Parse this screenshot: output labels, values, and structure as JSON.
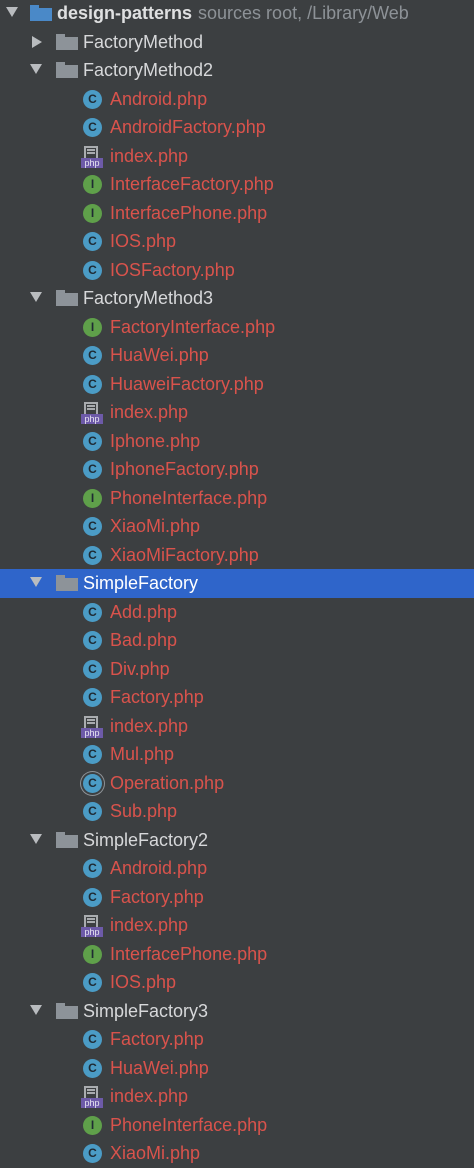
{
  "project_tree": {
    "root": {
      "name": "design-patterns",
      "suffix": "sources root,  /Library/Web",
      "icon": "folder-icon",
      "expanded": true
    },
    "rows": [
      {
        "kind": "dir",
        "label": "FactoryMethod",
        "expanded": false
      },
      {
        "kind": "dir",
        "label": "FactoryMethod2",
        "expanded": true
      },
      {
        "kind": "file",
        "icon": "class-icon",
        "label": "Android.php"
      },
      {
        "kind": "file",
        "icon": "class-icon",
        "label": "AndroidFactory.php"
      },
      {
        "kind": "file",
        "icon": "php-file-icon",
        "label": "index.php"
      },
      {
        "kind": "file",
        "icon": "interface-icon",
        "label": "InterfaceFactory.php"
      },
      {
        "kind": "file",
        "icon": "interface-icon",
        "label": "InterfacePhone.php"
      },
      {
        "kind": "file",
        "icon": "class-icon",
        "label": "IOS.php"
      },
      {
        "kind": "file",
        "icon": "class-icon",
        "label": "IOSFactory.php"
      },
      {
        "kind": "dir",
        "label": "FactoryMethod3",
        "expanded": true
      },
      {
        "kind": "file",
        "icon": "interface-icon",
        "label": "FactoryInterface.php"
      },
      {
        "kind": "file",
        "icon": "class-icon",
        "label": "HuaWei.php"
      },
      {
        "kind": "file",
        "icon": "class-icon",
        "label": "HuaweiFactory.php"
      },
      {
        "kind": "file",
        "icon": "php-file-icon",
        "label": "index.php"
      },
      {
        "kind": "file",
        "icon": "class-icon",
        "label": "Iphone.php"
      },
      {
        "kind": "file",
        "icon": "class-icon",
        "label": "IphoneFactory.php"
      },
      {
        "kind": "file",
        "icon": "interface-icon",
        "label": "PhoneInterface.php"
      },
      {
        "kind": "file",
        "icon": "class-icon",
        "label": "XiaoMi.php"
      },
      {
        "kind": "file",
        "icon": "class-icon",
        "label": "XiaoMiFactory.php"
      },
      {
        "kind": "dir",
        "label": "SimpleFactory",
        "expanded": true,
        "selected": true
      },
      {
        "kind": "file",
        "icon": "class-icon",
        "label": "Add.php"
      },
      {
        "kind": "file",
        "icon": "class-icon",
        "label": "Bad.php"
      },
      {
        "kind": "file",
        "icon": "class-icon",
        "label": "Div.php"
      },
      {
        "kind": "file",
        "icon": "class-icon",
        "label": "Factory.php"
      },
      {
        "kind": "file",
        "icon": "php-file-icon",
        "label": "index.php"
      },
      {
        "kind": "file",
        "icon": "class-icon",
        "label": "Mul.php"
      },
      {
        "kind": "file",
        "icon": "abstract-class-icon",
        "label": "Operation.php"
      },
      {
        "kind": "file",
        "icon": "class-icon",
        "label": "Sub.php"
      },
      {
        "kind": "dir",
        "label": "SimpleFactory2",
        "expanded": true
      },
      {
        "kind": "file",
        "icon": "class-icon",
        "label": "Android.php"
      },
      {
        "kind": "file",
        "icon": "class-icon",
        "label": "Factory.php"
      },
      {
        "kind": "file",
        "icon": "php-file-icon",
        "label": "index.php"
      },
      {
        "kind": "file",
        "icon": "interface-icon",
        "label": "InterfacePhone.php"
      },
      {
        "kind": "file",
        "icon": "class-icon",
        "label": "IOS.php"
      },
      {
        "kind": "dir",
        "label": "SimpleFactory3",
        "expanded": true
      },
      {
        "kind": "file",
        "icon": "class-icon",
        "label": "Factory.php"
      },
      {
        "kind": "file",
        "icon": "class-icon",
        "label": "HuaWei.php"
      },
      {
        "kind": "file",
        "icon": "php-file-icon",
        "label": "index.php"
      },
      {
        "kind": "file",
        "icon": "interface-icon",
        "label": "PhoneInterface.php"
      },
      {
        "kind": "file",
        "icon": "class-icon",
        "label": "XiaoMi.php"
      }
    ],
    "icon_glyphs": {
      "class": "C",
      "interface": "I",
      "php_tag": "php"
    },
    "colors": {
      "background": "#3c3f41",
      "selection": "#2f65ca",
      "file_text": "#d9534c",
      "dir_text": "#d7d8da",
      "class_icon": "#4b9cc6",
      "interface_icon": "#5fa04a",
      "php_tag": "#6d5aa8"
    }
  }
}
